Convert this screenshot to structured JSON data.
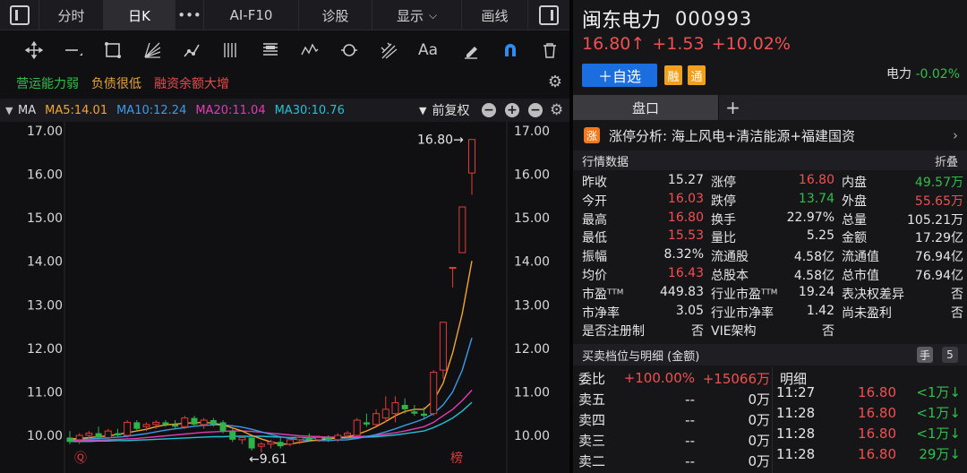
{
  "tabbar": {
    "tabs": [
      "分时",
      "日K",
      "•••",
      "AI-F10",
      "诊股",
      "显示",
      "画线"
    ]
  },
  "toolbar": {
    "text_tool": "Aa"
  },
  "tags": [
    "营运能力弱",
    "负债很低",
    "融资余额大增"
  ],
  "ma_row": {
    "label": "MA",
    "ma5": "MA5:14.01",
    "ma10": "MA10:12.24",
    "ma20": "MA20:11.04",
    "ma30": "MA30:10.76",
    "adjust": "前复权"
  },
  "chart_data": {
    "type": "candlestick",
    "y_ticks": [
      "17.00",
      "16.00",
      "15.00",
      "14.00",
      "13.00",
      "12.00",
      "11.00",
      "10.00"
    ],
    "ylim": [
      9.7,
      17.0
    ],
    "annotations": {
      "high": "16.80→",
      "low": "←9.61"
    },
    "markers": [
      "Ⓠ",
      "榜"
    ],
    "candles": [
      {
        "o": 9.95,
        "h": 10.1,
        "l": 9.8,
        "c": 9.85
      },
      {
        "o": 9.9,
        "h": 10.05,
        "l": 9.8,
        "c": 10.0
      },
      {
        "o": 10.0,
        "h": 10.1,
        "l": 9.9,
        "c": 10.05
      },
      {
        "o": 10.05,
        "h": 10.2,
        "l": 9.9,
        "c": 9.95
      },
      {
        "o": 9.95,
        "h": 10.15,
        "l": 9.9,
        "c": 10.1
      },
      {
        "o": 10.05,
        "h": 10.15,
        "l": 9.95,
        "c": 10.0
      },
      {
        "o": 10.0,
        "h": 10.35,
        "l": 9.95,
        "c": 10.3
      },
      {
        "o": 10.3,
        "h": 10.35,
        "l": 10.1,
        "c": 10.15
      },
      {
        "o": 10.2,
        "h": 10.3,
        "l": 10.1,
        "c": 10.25
      },
      {
        "o": 10.25,
        "h": 10.35,
        "l": 10.15,
        "c": 10.3
      },
      {
        "o": 10.3,
        "h": 10.35,
        "l": 10.2,
        "c": 10.25
      },
      {
        "o": 10.25,
        "h": 10.35,
        "l": 10.15,
        "c": 10.2
      },
      {
        "o": 10.2,
        "h": 10.45,
        "l": 10.15,
        "c": 10.4
      },
      {
        "o": 10.4,
        "h": 10.45,
        "l": 10.2,
        "c": 10.25
      },
      {
        "o": 10.25,
        "h": 10.4,
        "l": 10.15,
        "c": 10.35
      },
      {
        "o": 10.35,
        "h": 10.4,
        "l": 10.2,
        "c": 10.25
      },
      {
        "o": 10.3,
        "h": 10.35,
        "l": 10.05,
        "c": 10.1
      },
      {
        "o": 10.1,
        "h": 10.15,
        "l": 9.85,
        "c": 9.9
      },
      {
        "o": 9.9,
        "h": 10.0,
        "l": 9.8,
        "c": 9.95
      },
      {
        "o": 9.95,
        "h": 9.95,
        "l": 9.65,
        "c": 9.7
      },
      {
        "o": 9.75,
        "h": 9.85,
        "l": 9.61,
        "c": 9.8
      },
      {
        "o": 9.8,
        "h": 9.9,
        "l": 9.7,
        "c": 9.85
      },
      {
        "o": 9.85,
        "h": 9.95,
        "l": 9.7,
        "c": 9.75
      },
      {
        "o": 9.8,
        "h": 9.95,
        "l": 9.75,
        "c": 9.9
      },
      {
        "o": 9.9,
        "h": 10.0,
        "l": 9.8,
        "c": 9.95
      },
      {
        "o": 9.95,
        "h": 10.05,
        "l": 9.85,
        "c": 9.9
      },
      {
        "o": 9.9,
        "h": 10.0,
        "l": 9.85,
        "c": 9.95
      },
      {
        "o": 9.95,
        "h": 10.0,
        "l": 9.85,
        "c": 9.9
      },
      {
        "o": 9.9,
        "h": 10.05,
        "l": 9.85,
        "c": 10.0
      },
      {
        "o": 10.0,
        "h": 10.1,
        "l": 9.9,
        "c": 10.05
      },
      {
        "o": 10.0,
        "h": 10.4,
        "l": 9.95,
        "c": 10.35
      },
      {
        "o": 10.3,
        "h": 10.5,
        "l": 10.2,
        "c": 10.25
      },
      {
        "o": 10.25,
        "h": 10.6,
        "l": 10.2,
        "c": 10.5
      },
      {
        "o": 10.4,
        "h": 10.9,
        "l": 10.3,
        "c": 10.6
      },
      {
        "o": 10.5,
        "h": 10.9,
        "l": 10.3,
        "c": 10.75
      },
      {
        "o": 10.7,
        "h": 10.85,
        "l": 10.5,
        "c": 10.6
      },
      {
        "o": 10.55,
        "h": 10.7,
        "l": 10.45,
        "c": 10.5
      },
      {
        "o": 10.5,
        "h": 10.65,
        "l": 10.4,
        "c": 10.45
      },
      {
        "o": 10.5,
        "h": 11.5,
        "l": 10.45,
        "c": 11.45
      },
      {
        "o": 11.5,
        "h": 12.6,
        "l": 11.3,
        "c": 12.6
      },
      {
        "o": 13.86,
        "h": 13.86,
        "l": 13.4,
        "c": 13.86
      },
      {
        "o": 14.2,
        "h": 15.25,
        "l": 14.2,
        "c": 15.25
      },
      {
        "o": 16.03,
        "h": 16.8,
        "l": 15.53,
        "c": 16.8
      }
    ],
    "ma5": [
      9.92,
      9.93,
      9.95,
      9.97,
      9.99,
      10.02,
      10.06,
      10.1,
      10.14,
      10.2,
      10.24,
      10.26,
      10.28,
      10.29,
      10.3,
      10.28,
      10.24,
      10.17,
      10.1,
      10.0,
      9.92,
      9.85,
      9.8,
      9.8,
      9.84,
      9.87,
      9.9,
      9.92,
      9.94,
      9.96,
      10.02,
      10.1,
      10.2,
      10.32,
      10.45,
      10.55,
      10.6,
      10.6,
      10.8,
      11.2,
      11.9,
      12.8,
      14.01
    ],
    "ma10": [
      9.9,
      9.91,
      9.92,
      9.93,
      9.94,
      9.96,
      9.98,
      10.01,
      10.04,
      10.08,
      10.12,
      10.15,
      10.18,
      10.21,
      10.23,
      10.24,
      10.24,
      10.22,
      10.19,
      10.14,
      10.08,
      10.02,
      9.97,
      9.93,
      9.9,
      9.89,
      9.88,
      9.88,
      9.89,
      9.9,
      9.93,
      9.97,
      10.02,
      10.08,
      10.15,
      10.23,
      10.3,
      10.38,
      10.5,
      10.7,
      11.0,
      11.5,
      12.24
    ],
    "ma20": [
      9.88,
      9.88,
      9.89,
      9.89,
      9.9,
      9.91,
      9.92,
      9.93,
      9.95,
      9.97,
      9.99,
      10.01,
      10.03,
      10.05,
      10.07,
      10.08,
      10.09,
      10.1,
      10.1,
      10.09,
      10.07,
      10.05,
      10.03,
      10.01,
      9.99,
      9.98,
      9.97,
      9.96,
      9.96,
      9.96,
      9.97,
      9.98,
      10.0,
      10.03,
      10.06,
      10.1,
      10.15,
      10.2,
      10.3,
      10.45,
      10.6,
      10.8,
      11.04
    ],
    "ma30": [
      9.86,
      9.86,
      9.86,
      9.87,
      9.87,
      9.88,
      9.88,
      9.89,
      9.9,
      9.91,
      9.92,
      9.93,
      9.94,
      9.95,
      9.96,
      9.97,
      9.97,
      9.98,
      9.98,
      9.98,
      9.98,
      9.97,
      9.96,
      9.95,
      9.95,
      9.94,
      9.94,
      9.94,
      9.94,
      9.94,
      9.95,
      9.96,
      9.97,
      9.99,
      10.01,
      10.04,
      10.07,
      10.1,
      10.18,
      10.28,
      10.4,
      10.56,
      10.76
    ]
  },
  "stock": {
    "name": "闽东电力",
    "code": "000993",
    "price": "16.80↑",
    "change": "+1.53",
    "change_pct": "+10.02%",
    "add_watch": "＋自选",
    "badge_rong": "融",
    "badge_tong": "通",
    "sector_name": "电力",
    "sector_change": "-0.02%"
  },
  "panel_tabs": {
    "pankou": "盘口",
    "plus": "+"
  },
  "limit_analysis": {
    "icon": "涨",
    "text": "涨停分析: 海上风电+清洁能源+福建国资",
    "arrow": "›"
  },
  "quotes": {
    "title": "行情数据",
    "fold": "折叠",
    "rows": [
      [
        {
          "k": "昨收",
          "v": "15.27",
          "c": ""
        },
        {
          "k": "涨停",
          "v": "16.80",
          "c": "red"
        },
        {
          "k": "内盘",
          "v": "49.57万",
          "c": "green"
        }
      ],
      [
        {
          "k": "今开",
          "v": "16.03",
          "c": "red"
        },
        {
          "k": "跌停",
          "v": "13.74",
          "c": "green"
        },
        {
          "k": "外盘",
          "v": "55.65万",
          "c": "red"
        }
      ],
      [
        {
          "k": "最高",
          "v": "16.80",
          "c": "red"
        },
        {
          "k": "换手",
          "v": "22.97%",
          "c": ""
        },
        {
          "k": "总量",
          "v": "105.21万",
          "c": ""
        }
      ],
      [
        {
          "k": "最低",
          "v": "15.53",
          "c": "red"
        },
        {
          "k": "量比",
          "v": "5.25",
          "c": ""
        },
        {
          "k": "金额",
          "v": "17.29亿",
          "c": ""
        }
      ],
      [
        {
          "k": "振幅",
          "v": "8.32%",
          "c": ""
        },
        {
          "k": "流通股",
          "v": "4.58亿",
          "c": ""
        },
        {
          "k": "流通值",
          "v": "76.94亿",
          "c": ""
        }
      ],
      [
        {
          "k": "均价",
          "v": "16.43",
          "c": "red"
        },
        {
          "k": "总股本",
          "v": "4.58亿",
          "c": ""
        },
        {
          "k": "总市值",
          "v": "76.94亿",
          "c": ""
        }
      ],
      [
        {
          "k": "市盈ᵀᵀᴹ",
          "v": "449.83",
          "c": ""
        },
        {
          "k": "行业市盈ᵀᵀᴹ",
          "v": "19.24",
          "c": ""
        },
        {
          "k": "表决权差异",
          "v": "否",
          "c": ""
        }
      ],
      [
        {
          "k": "市净率",
          "v": "3.05",
          "c": ""
        },
        {
          "k": "行业市净率",
          "v": "1.42",
          "c": ""
        },
        {
          "k": "尚未盈利",
          "v": "否",
          "c": ""
        }
      ],
      [
        {
          "k": "是否注册制",
          "v": "否",
          "c": ""
        },
        {
          "k": "VIE架构",
          "v": "否",
          "c": ""
        },
        {
          "k": "",
          "v": "",
          "c": ""
        }
      ]
    ]
  },
  "orderbook": {
    "title": "买卖档位与明细 (金额)",
    "icon_hand": "手",
    "icon_five": "5",
    "weibi_label": "委比",
    "weibi_pct": "+100.00%",
    "weibi_amt": "+15066万",
    "asks": [
      {
        "label": "卖五",
        "price": "--",
        "amt": "0万"
      },
      {
        "label": "卖四",
        "price": "--",
        "amt": "0万"
      },
      {
        "label": "卖三",
        "price": "--",
        "amt": "0万"
      },
      {
        "label": "卖二",
        "price": "--",
        "amt": "0万"
      }
    ],
    "detail_title": "明细",
    "details": [
      {
        "time": "11:27",
        "price": "16.80",
        "vol": "<1万↓"
      },
      {
        "time": "11:28",
        "price": "16.80",
        "vol": "<1万↓"
      },
      {
        "time": "11:28",
        "price": "16.80",
        "vol": "<1万↓"
      },
      {
        "time": "11:28",
        "price": "16.80",
        "vol": "29万↓"
      }
    ]
  }
}
